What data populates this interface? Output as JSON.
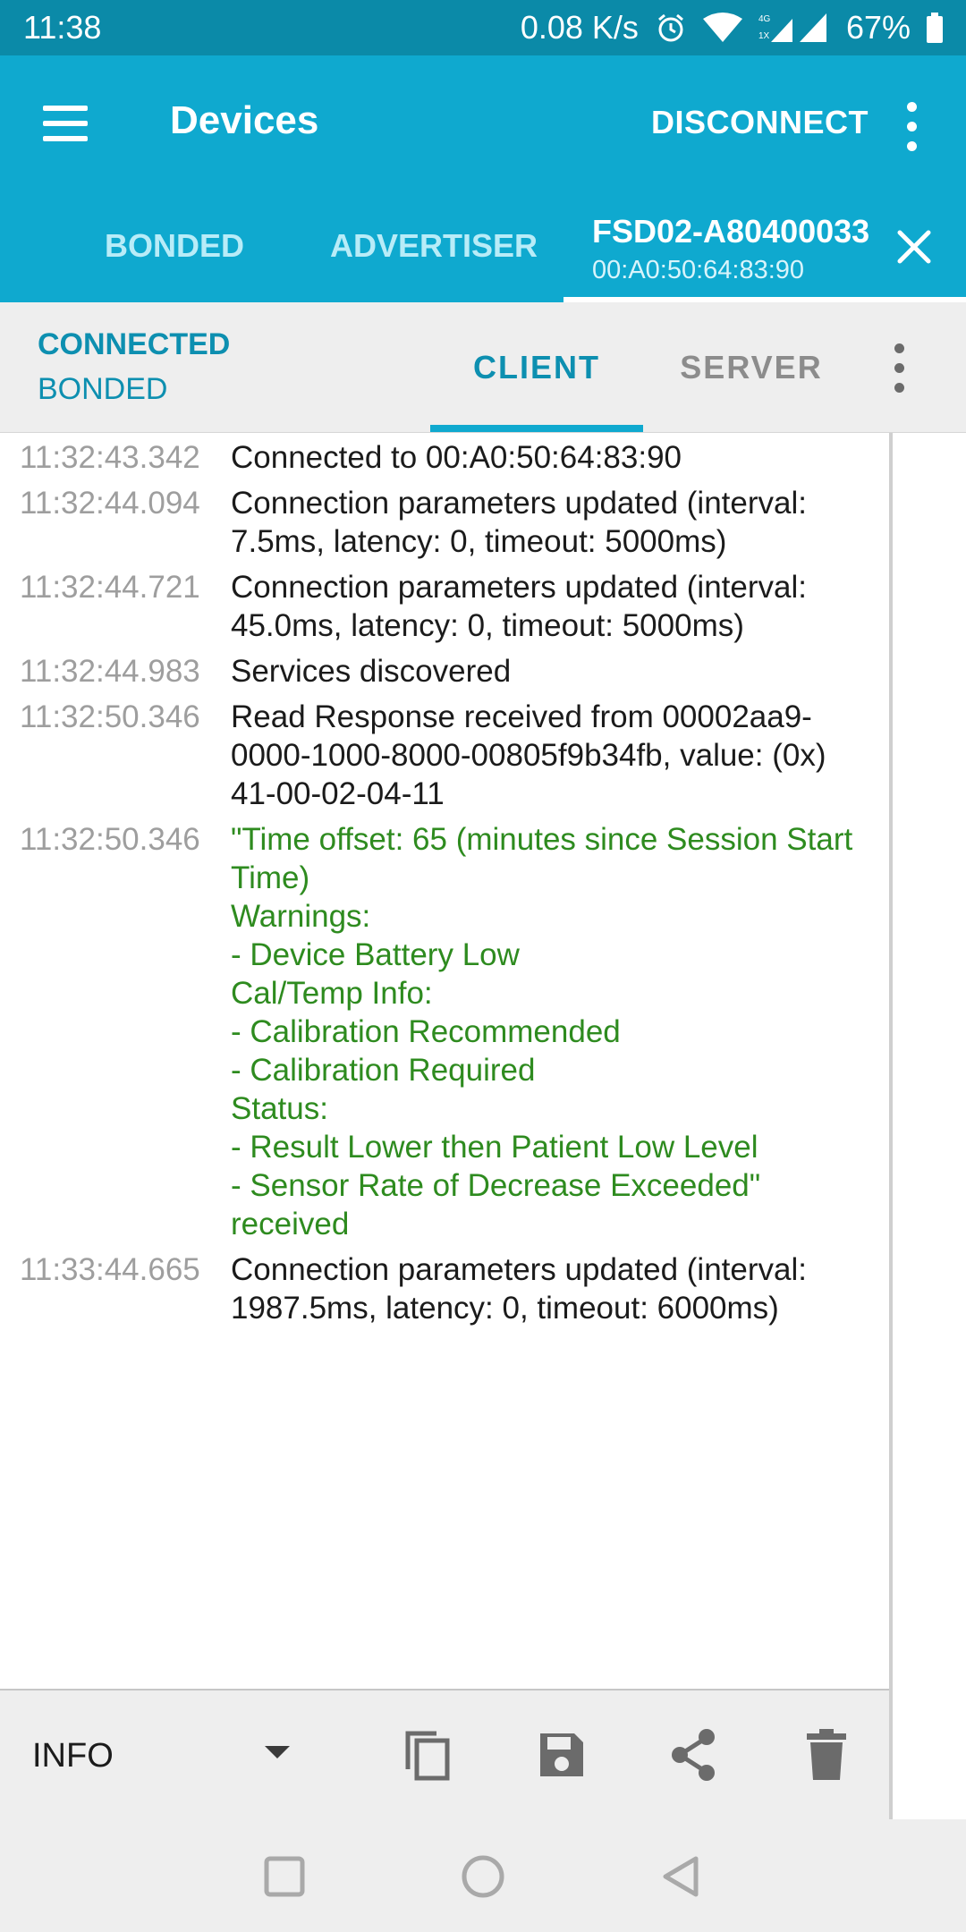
{
  "status_bar": {
    "time": "11:38",
    "net_speed": "0.08 K/s",
    "battery": "67%",
    "network_label_top": "4G",
    "network_label_bottom": "1X",
    "icons": [
      "alarm-icon",
      "wifi-icon",
      "signal-icon",
      "battery-icon"
    ]
  },
  "app_bar": {
    "title": "Devices",
    "disconnect_label": "DISCONNECT",
    "tabs": [
      {
        "label": "BONDED"
      },
      {
        "label": "ADVERTISER"
      }
    ],
    "device_tab": {
      "name": "FSD02-A80400033",
      "address": "00:A0:50:64:83:90"
    }
  },
  "device_bar": {
    "connection_state": "CONNECTED",
    "bond_state": "BONDED",
    "tabs": [
      {
        "label": "CLIENT",
        "active": true
      },
      {
        "label": "SERVER",
        "active": false
      }
    ]
  },
  "log": {
    "entries": [
      {
        "time": "11:32:43.342",
        "message": "Connected to 00:A0:50:64:83:90",
        "color": "#1b1b1b"
      },
      {
        "time": "11:32:44.094",
        "message": "Connection parameters updated (interval: 7.5ms, latency: 0, timeout: 5000ms)",
        "color": "#1b1b1b"
      },
      {
        "time": "11:32:44.721",
        "message": "Connection parameters updated (interval: 45.0ms, latency: 0, timeout: 5000ms)",
        "color": "#1b1b1b"
      },
      {
        "time": "11:32:44.983",
        "message": "Services discovered",
        "color": "#1b1b1b"
      },
      {
        "time": "11:32:50.346",
        "message": "Read Response received from 00002aa9-0000-1000-8000-00805f9b34fb, value: (0x) 41-00-02-04-11",
        "color": "#1b1b1b"
      },
      {
        "time": "11:32:50.346",
        "message": "\"Time offset: 65 (minutes since Session Start Time)\nWarnings:\n- Device Battery Low\nCal/Temp Info:\n- Calibration Recommended\n- Calibration Required\nStatus:\n- Result Lower then Patient Low Level\n- Sensor Rate of Decrease Exceeded\"\nreceived",
        "color": "#2e8b1f"
      },
      {
        "time": "11:33:44.665",
        "message": "Connection parameters updated (interval: 1987.5ms, latency: 0, timeout: 6000ms)",
        "color": "#1b1b1b"
      }
    ]
  },
  "bottom_bar": {
    "log_level": "INFO",
    "actions": [
      "copy-icon",
      "save-icon",
      "share-icon",
      "delete-icon"
    ]
  },
  "nav_bar": {
    "buttons": [
      "recents-button",
      "home-button",
      "back-button"
    ]
  },
  "colors": {
    "app_bar": "#0fa9cf",
    "status_bar": "#0b8aa8",
    "accent": "#0d8fb0",
    "log_green": "#2e8b1f"
  }
}
